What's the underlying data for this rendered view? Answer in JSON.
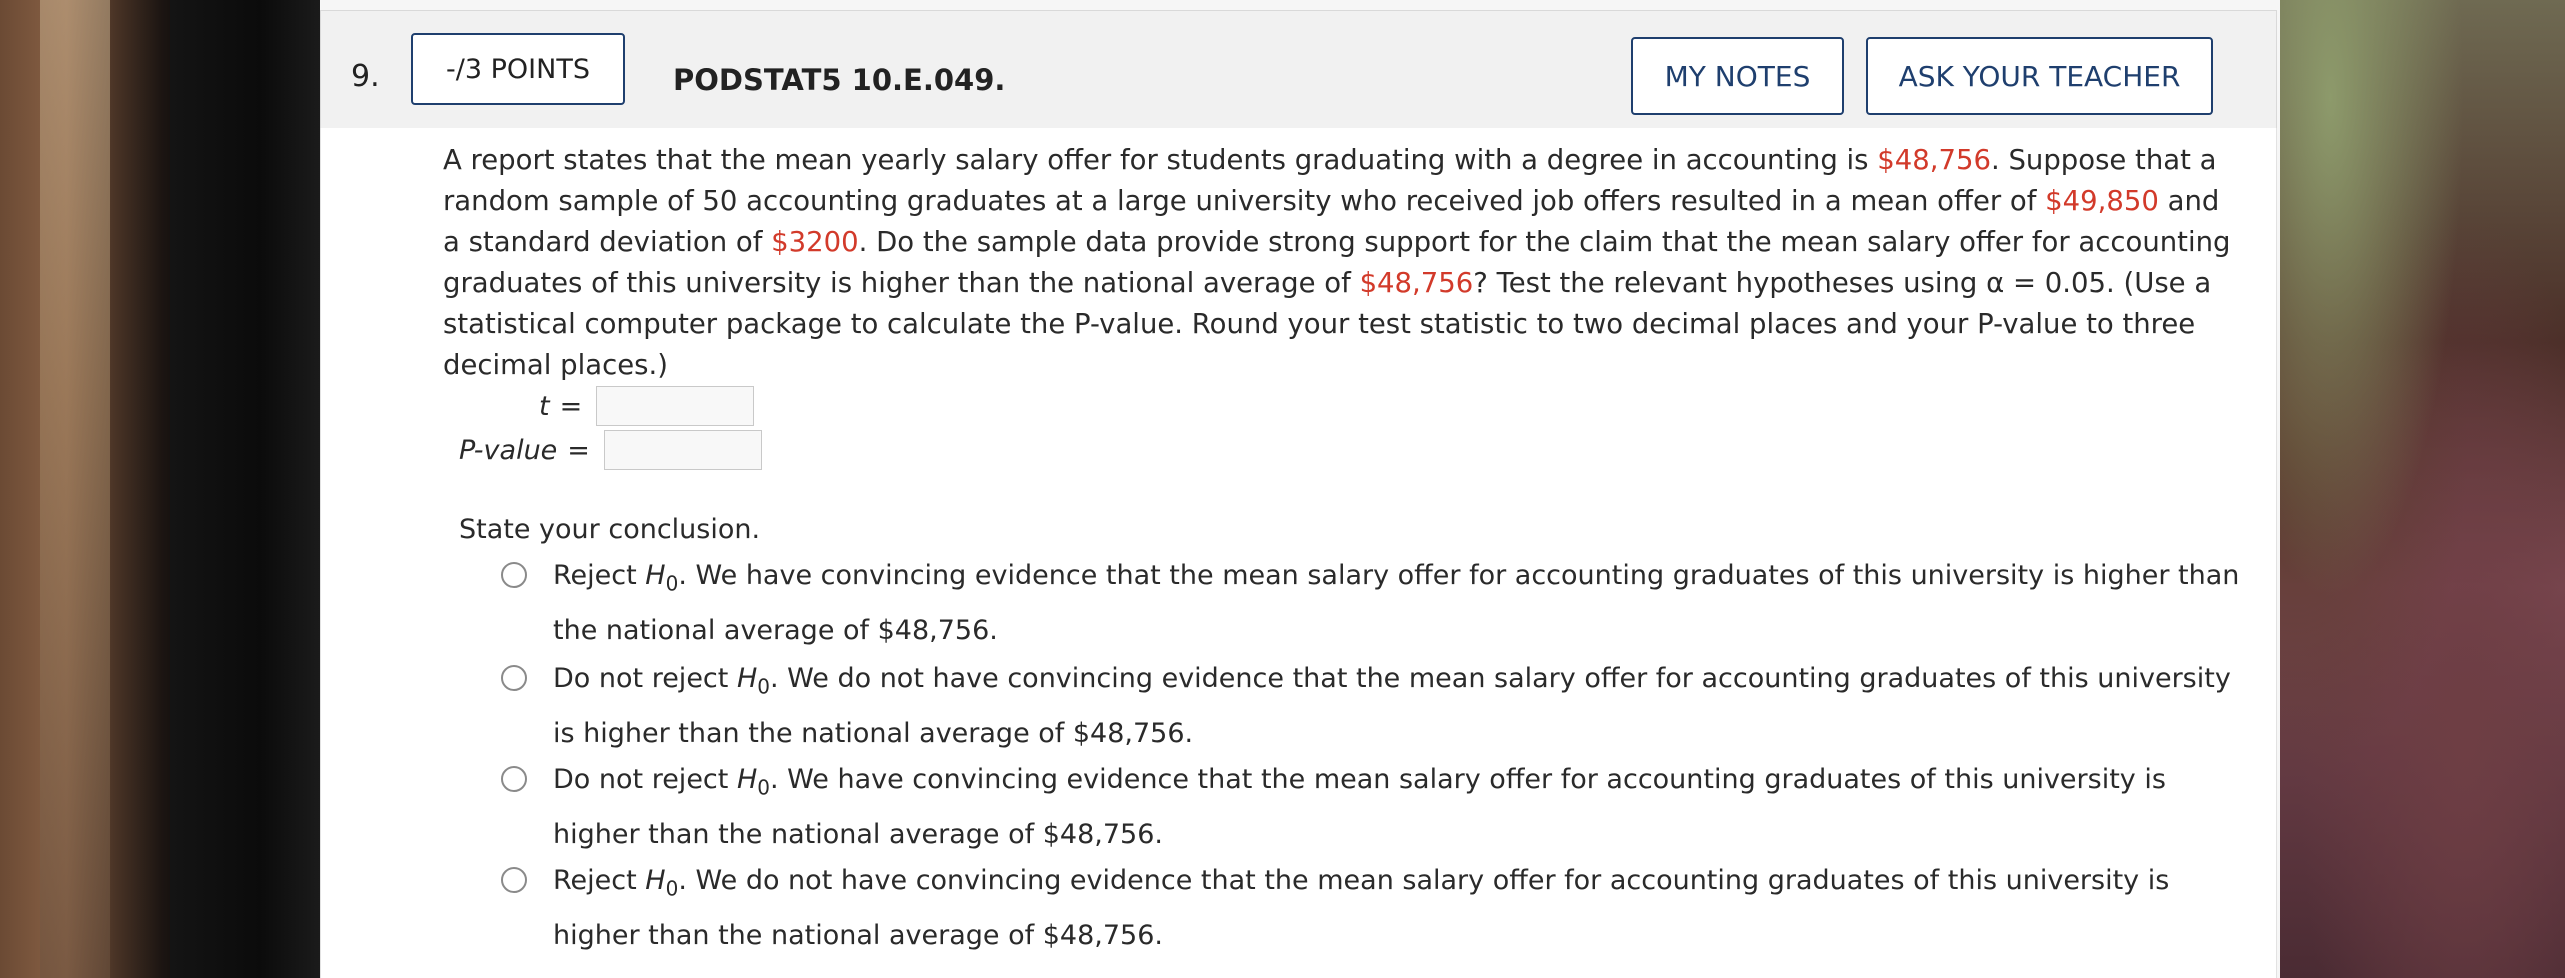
{
  "question": {
    "number": "9.",
    "points_label": "-/3 POINTS",
    "code": "PODSTAT5 10.E.049.",
    "my_notes_label": "MY NOTES",
    "ask_teacher_label": "ASK YOUR TEACHER"
  },
  "problem": {
    "p1": "A report states that the mean yearly salary offer for students graduating with a degree in accounting is ",
    "v1": "$48,756",
    "p2": ". Suppose that a random sample of 50 accounting graduates at a large university who received job offers resulted in a mean offer of ",
    "v2": "$49,850",
    "p3": " and a standard deviation of ",
    "v3": "$3200",
    "p4": ". Do the sample data provide strong support for the claim that the mean salary offer for accounting graduates of this university is higher than the national average of ",
    "v4": "$48,756",
    "p5": "? Test the relevant hypotheses using α = 0.05. (Use a statistical computer package to calculate the P-value. Round your test statistic to two decimal places and your P-value to three decimal places.)"
  },
  "answers": {
    "t_label": "t",
    "p_label": "P-value",
    "equals": "="
  },
  "conclusion": {
    "prompt": "State your conclusion.",
    "h0": "H",
    "h0_sub": "0",
    "options": [
      {
        "lead": "Reject ",
        "text": ". We have convincing evidence that the mean salary offer for accounting graduates of this university is higher than the national average of $48,756."
      },
      {
        "lead": "Do not reject ",
        "text": ". We do not have convincing evidence that the mean salary offer for accounting graduates of this university is higher than the national average of $48,756."
      },
      {
        "lead": "Do not reject ",
        "text": ". We have convincing evidence that the mean salary offer for accounting graduates of this university is higher than the national average of $48,756."
      },
      {
        "lead": "Reject ",
        "text": ". We do not have convincing evidence that the mean salary offer for accounting graduates of this university is higher than the national average of $48,756."
      }
    ]
  }
}
